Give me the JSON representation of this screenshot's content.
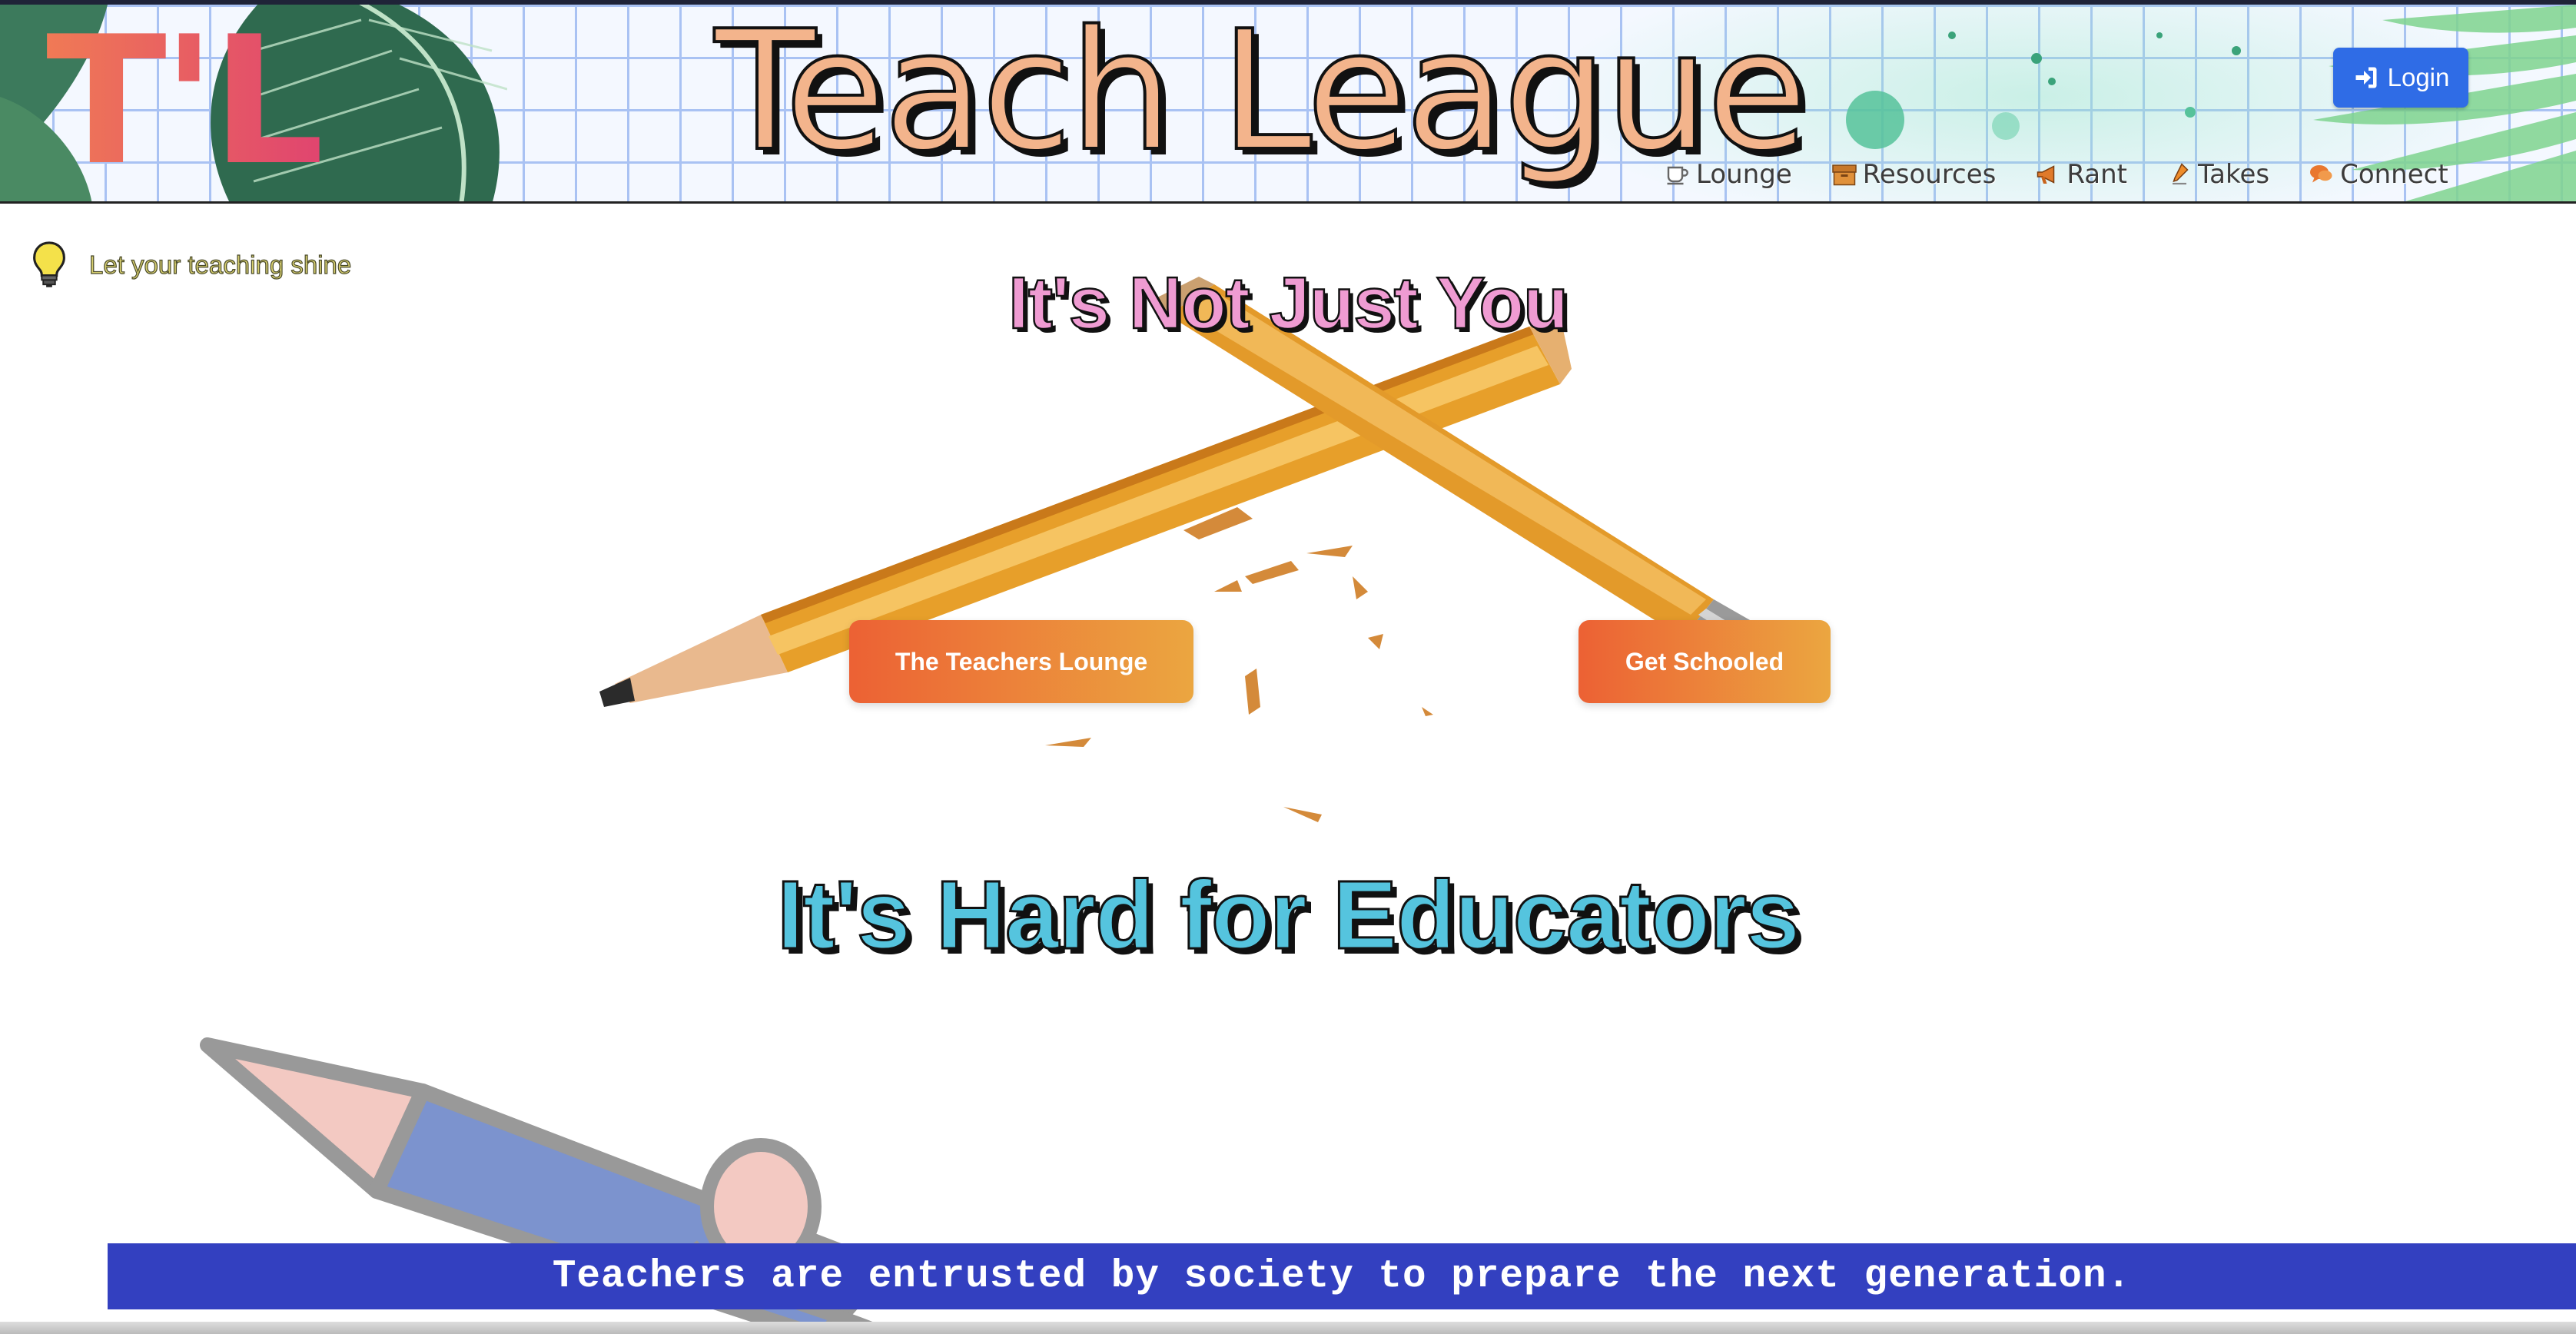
{
  "header": {
    "logo_text": "T'L",
    "site_title": "Teach League",
    "login_label": "Login",
    "nav": [
      {
        "label": "Lounge",
        "icon": "cup-icon"
      },
      {
        "label": "Resources",
        "icon": "box-icon"
      },
      {
        "label": "Rant",
        "icon": "megaphone-icon"
      },
      {
        "label": "Takes",
        "icon": "pen-icon"
      },
      {
        "label": "Connect",
        "icon": "chat-icon"
      }
    ]
  },
  "tagline": {
    "text": "Let your teaching shine",
    "icon": "lightbulb-icon"
  },
  "hero": {
    "title": "It's Not Just You",
    "buttons": {
      "lounge": "The Teachers Lounge",
      "schooled": "Get Schooled"
    },
    "subtitle": "It's Hard for Educators"
  },
  "banner": {
    "text": "Teachers are entrusted by society to prepare the next generation."
  },
  "colors": {
    "accent_blue": "#2f6ce6",
    "banner_blue": "#3340c0",
    "cta_gradient_start": "#ec6134",
    "cta_gradient_end": "#eba640",
    "title_peach": "#f3b48c",
    "hero_pink": "#ef9bd2",
    "sub_cyan": "#55c4de"
  }
}
